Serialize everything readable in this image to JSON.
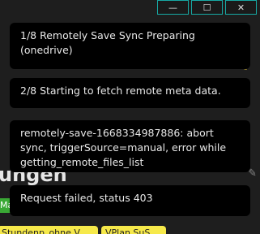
{
  "window_controls": {
    "minimize": "—",
    "maximize": "☐",
    "close": "✕"
  },
  "background": {
    "heading": "ungen",
    "tags": [
      "Ma",
      "",
      "",
      ""
    ],
    "pills": [
      "Stundenp_ohne V",
      "VPlan SuS"
    ]
  },
  "notices": [
    {
      "text": "1/8 Remotely Save Sync Preparing (onedrive)"
    },
    {
      "text": "2/8 Starting to fetch remote meta data."
    },
    {
      "text": "remotely-save-1668334987886: abort sync, triggerSource=manual, error while getting_remote_files_list"
    },
    {
      "text": "Request failed, status 403"
    }
  ],
  "icons": {
    "chevron": "chevron-down-icon",
    "sidebar": "sidebar-toggle-icon",
    "edit_yellow": "pencil-icon",
    "edit_grey": "pencil-icon"
  }
}
